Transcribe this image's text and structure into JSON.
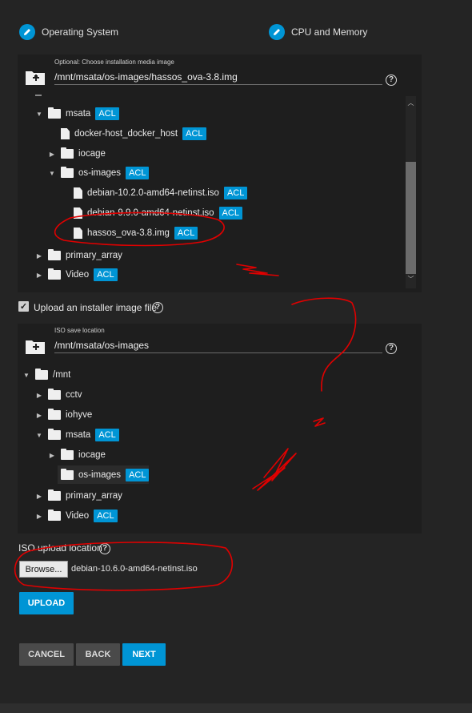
{
  "steps": [
    {
      "label": "Operating System"
    },
    {
      "label": "CPU and Memory"
    }
  ],
  "install_media": {
    "label": "Optional: Choose installation media image",
    "value": "/mnt/msata/os-images/hassos_ova-3.8.img",
    "tree": [
      {
        "label": "msata",
        "acl": "ACL",
        "arrow": "▼",
        "icon": "folder"
      },
      {
        "label": "docker-host_docker_host",
        "acl": "ACL",
        "arrow": "",
        "icon": "file"
      },
      {
        "label": "iocage",
        "acl": "",
        "arrow": "▶",
        "icon": "folder"
      },
      {
        "label": "os-images",
        "acl": "ACL",
        "arrow": "▼",
        "icon": "folder"
      },
      {
        "label": "debian-10.2.0-amd64-netinst.iso",
        "acl": "ACL",
        "arrow": "",
        "icon": "file"
      },
      {
        "label": "debian-9.9.0-amd64-netinst.iso",
        "acl": "ACL",
        "arrow": "",
        "icon": "file"
      },
      {
        "label": "hassos_ova-3.8.img",
        "acl": "ACL",
        "arrow": "",
        "icon": "file"
      },
      {
        "label": "primary_array",
        "acl": "",
        "arrow": "▶",
        "icon": "folder"
      },
      {
        "label": "Video",
        "acl": "ACL",
        "arrow": "▶",
        "icon": "folder"
      }
    ]
  },
  "upload_checkbox": {
    "label": "Upload an installer image file",
    "checked": true
  },
  "iso_save": {
    "label": "ISO save location",
    "value": "/mnt/msata/os-images",
    "tree": [
      {
        "label": "/mnt",
        "acl": "",
        "arrow": "▼",
        "icon": "folder"
      },
      {
        "label": "cctv",
        "acl": "",
        "arrow": "▶",
        "icon": "folder"
      },
      {
        "label": "iohyve",
        "acl": "",
        "arrow": "▶",
        "icon": "folder"
      },
      {
        "label": "msata",
        "acl": "ACL",
        "arrow": "▼",
        "icon": "folder"
      },
      {
        "label": "iocage",
        "acl": "",
        "arrow": "▶",
        "icon": "folder"
      },
      {
        "label": "os-images",
        "acl": "ACL",
        "arrow": "",
        "icon": "folder"
      },
      {
        "label": "primary_array",
        "acl": "",
        "arrow": "▶",
        "icon": "folder"
      },
      {
        "label": "Video",
        "acl": "ACL",
        "arrow": "▶",
        "icon": "folder"
      }
    ]
  },
  "iso_upload": {
    "label": "ISO upload location",
    "browse": "Browse...",
    "filename": "debian-10.6.0-amd64-netinst.iso"
  },
  "buttons": {
    "upload": "UPLOAD",
    "cancel": "CANCEL",
    "back": "BACK",
    "next": "NEXT"
  },
  "colors": {
    "accent": "#0095d5",
    "annotation": "#e00000"
  },
  "icons": {
    "help": "?",
    "check": "✓"
  }
}
